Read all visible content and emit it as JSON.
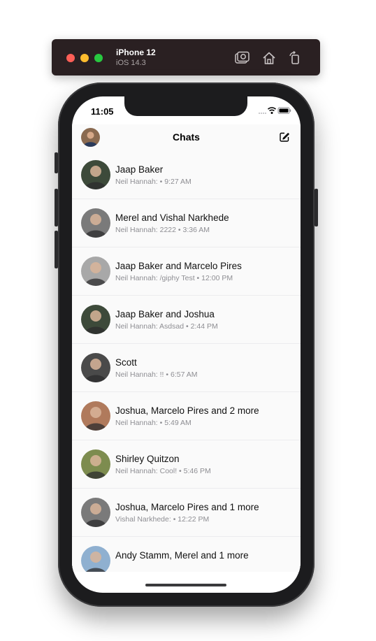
{
  "simulator": {
    "device": "iPhone 12",
    "os": "iOS 14.3",
    "icons": [
      "screenshot-icon",
      "home-icon",
      "rotate-icon"
    ],
    "colors": {
      "close": "#fe5f57",
      "minimize": "#febc2e",
      "zoom": "#28c840"
    }
  },
  "status": {
    "time": "11:05"
  },
  "nav": {
    "title": "Chats"
  },
  "chats": [
    {
      "name": "Jaap Baker",
      "sender": "Neil Hannah:",
      "message": "",
      "time": "9:27 AM",
      "avatar": "#3d4a3a"
    },
    {
      "name": "Merel and Vishal Narkhede",
      "sender": "Neil Hannah:",
      "message": "2222",
      "time": "3:36 AM",
      "avatar": "#7a7a7a"
    },
    {
      "name": "Jaap Baker and Marcelo Pires",
      "sender": "Neil Hannah:",
      "message": "/giphy Test",
      "time": "12:00 PM",
      "avatar": "#a8a8a8"
    },
    {
      "name": "Jaap Baker and Joshua",
      "sender": "Neil Hannah:",
      "message": "Asdsad",
      "time": "2:44 PM",
      "avatar": "#3d4a3a"
    },
    {
      "name": "Scott",
      "sender": "Neil Hannah:",
      "message": "!!",
      "time": "6:57 AM",
      "avatar": "#4a4a4a"
    },
    {
      "name": "Joshua, Marcelo Pires and 2 more",
      "sender": "Neil Hannah:",
      "message": "",
      "time": "5:49 AM",
      "avatar": "#b07a5c"
    },
    {
      "name": "Shirley Quitzon",
      "sender": "Neil Hannah:",
      "message": "Cool!",
      "time": "5:46 PM",
      "avatar": "#7d8c4f"
    },
    {
      "name": "Joshua, Marcelo Pires and 1 more",
      "sender": "Vishal Narkhede:",
      "message": "",
      "time": "12:22 PM",
      "avatar": "#7a7a7a"
    },
    {
      "name": "Andy Stamm, Merel and 1 more",
      "sender": "",
      "message": "",
      "time": "",
      "avatar": "#8fb0d0"
    }
  ]
}
